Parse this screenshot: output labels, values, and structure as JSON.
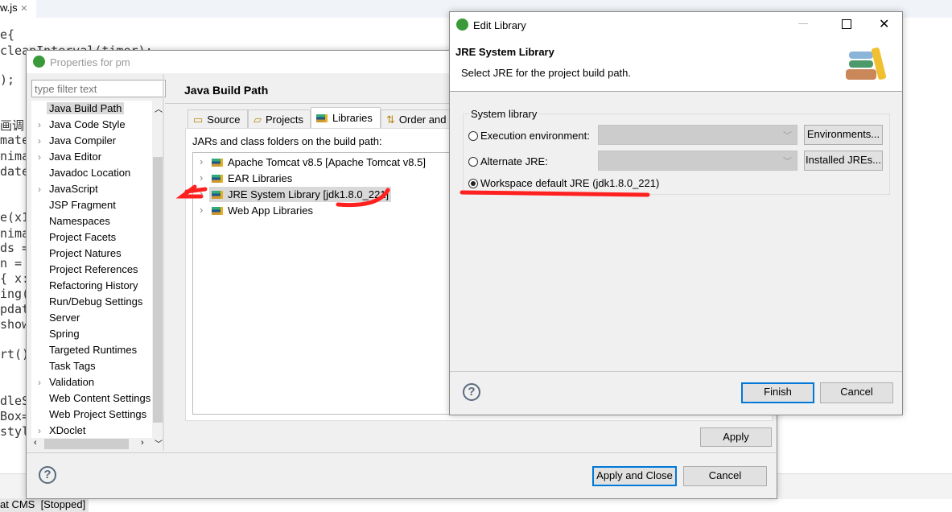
{
  "editor": {
    "tab_label": "w.js",
    "code_lines": [
      "e{",
      "cleanInterval(timer);",
      ");",
      "画调",
      "mate",
      "nima",
      "date",
      "e(x1",
      "nima",
      "ds =",
      "n =",
      "{ x:",
      "ing(",
      "pdat",
      "show",
      "rt()",
      "dleS",
      "Box=",
      "styl"
    ],
    "status_text": "at CMS  [Stopped]"
  },
  "properties_dialog": {
    "title": "Properties for pm",
    "filter_placeholder": "type filter text",
    "tree_items": [
      {
        "label": "Java Build Path",
        "expandable": false,
        "selected": true
      },
      {
        "label": "Java Code Style",
        "expandable": true
      },
      {
        "label": "Java Compiler",
        "expandable": true
      },
      {
        "label": "Java Editor",
        "expandable": true
      },
      {
        "label": "Javadoc Location",
        "expandable": false
      },
      {
        "label": "JavaScript",
        "expandable": true
      },
      {
        "label": "JSP Fragment",
        "expandable": false
      },
      {
        "label": "Namespaces",
        "expandable": false
      },
      {
        "label": "Project Facets",
        "expandable": false
      },
      {
        "label": "Project Natures",
        "expandable": false
      },
      {
        "label": "Project References",
        "expandable": false
      },
      {
        "label": "Refactoring History",
        "expandable": false
      },
      {
        "label": "Run/Debug Settings",
        "expandable": false
      },
      {
        "label": "Server",
        "expandable": false
      },
      {
        "label": "Spring",
        "expandable": false
      },
      {
        "label": "Targeted Runtimes",
        "expandable": false
      },
      {
        "label": "Task Tags",
        "expandable": false
      },
      {
        "label": "Validation",
        "expandable": true
      },
      {
        "label": "Web Content Settings",
        "expandable": false
      },
      {
        "label": "Web Project Settings",
        "expandable": false
      },
      {
        "label": "XDoclet",
        "expandable": true
      }
    ],
    "page_title": "Java Build Path",
    "tabs": [
      {
        "label": "Source",
        "icon": "source-folder-icon"
      },
      {
        "label": "Projects",
        "icon": "project-folder-icon"
      },
      {
        "label": "Libraries",
        "icon": "library-icon",
        "active": true
      },
      {
        "label": "Order and",
        "icon": "order-icon"
      }
    ],
    "list_caption": "JARs and class folders on the build path:",
    "libraries": [
      {
        "label": "Apache Tomcat v8.5 [Apache Tomcat v8.5]"
      },
      {
        "label": "EAR Libraries"
      },
      {
        "label": "JRE System Library [jdk1.8.0_221]",
        "selected": true
      },
      {
        "label": "Web App Libraries"
      }
    ],
    "apply_label": "Apply",
    "apply_close_label": "Apply and Close",
    "cancel_label": "Cancel"
  },
  "edit_library": {
    "title": "Edit Library",
    "header_title": "JRE System Library",
    "header_desc": "Select JRE for the project build path.",
    "group_label": "System library",
    "options": [
      {
        "label": "Execution environment:",
        "selected": false,
        "button": "Environments..."
      },
      {
        "label": "Alternate JRE:",
        "selected": false,
        "button": "Installed JREs..."
      },
      {
        "label": "Workspace default JRE (jdk1.8.0_221)",
        "selected": true
      }
    ],
    "finish_label": "Finish",
    "cancel_label": "Cancel"
  },
  "colors": {
    "annotation": "#ff2020",
    "accent": "#0078d7"
  }
}
